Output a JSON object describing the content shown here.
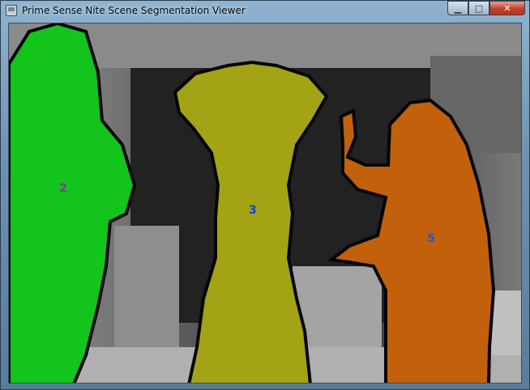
{
  "window": {
    "title": "Prime Sense Nite Scene Segmentation Viewer",
    "controls": {
      "minimize_icon": "minimize-icon",
      "maximize_icon": "maximize-icon",
      "close_icon": "close-icon"
    }
  },
  "scene": {
    "users": [
      {
        "id": "2",
        "color": "#12c41b",
        "label_color": "#7a3f8e"
      },
      {
        "id": "3",
        "color": "#a3a315",
        "label_color": "#1d3fd6"
      },
      {
        "id": "5",
        "color": "#c2600c",
        "label_color": "#2555d8"
      }
    ]
  }
}
